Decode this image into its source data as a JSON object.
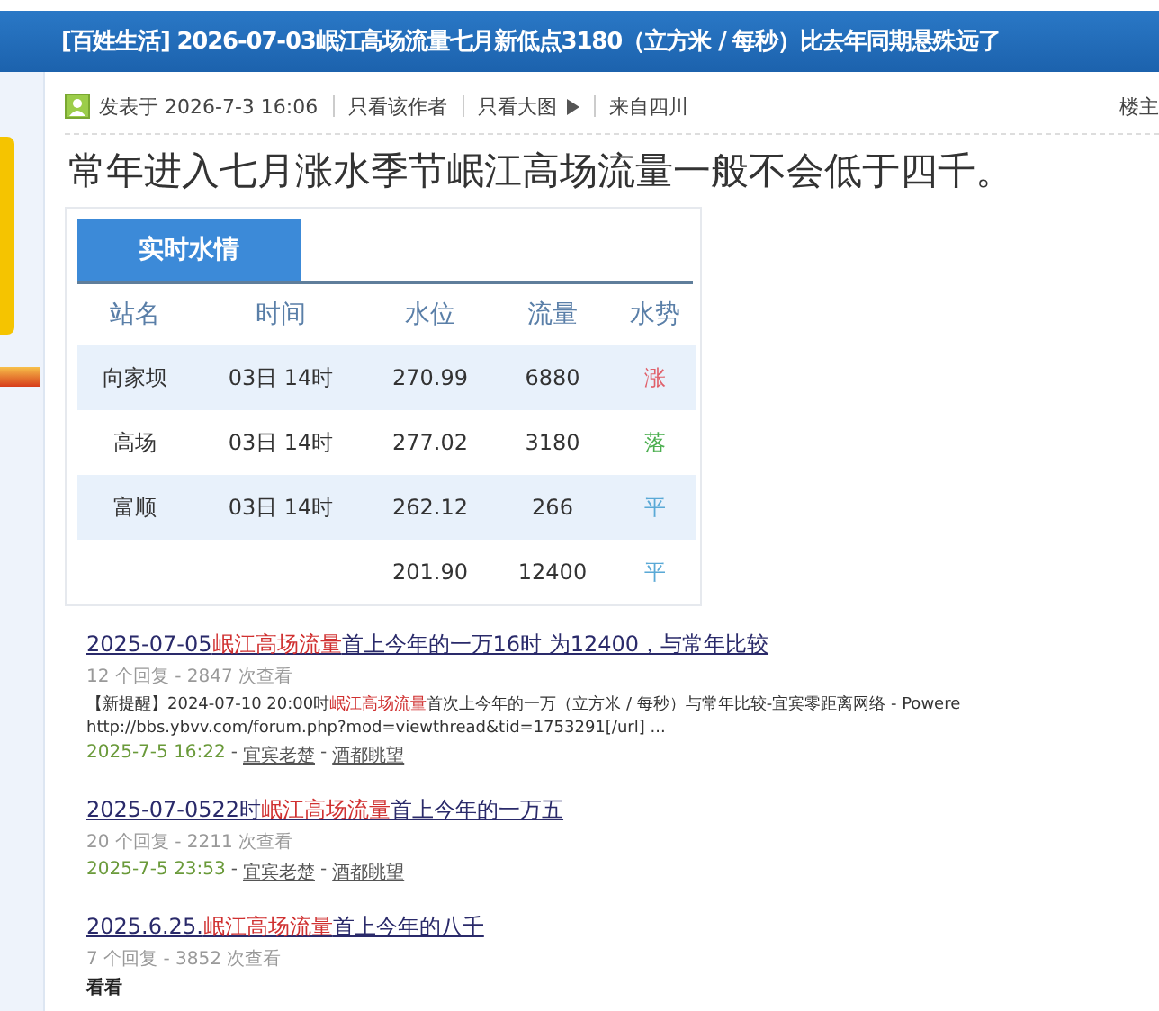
{
  "thread_title": "[百姓生活] 2026-07-03岷江高场流量七月新低点3180（立方米 / 每秒）比去年同期悬殊远了",
  "post_meta": {
    "posted": "发表于 2026-7-3 16:06",
    "only_author": "只看该作者",
    "only_images": "只看大图",
    "from": "来自四川",
    "floor": "楼主"
  },
  "headline": "常年进入七月涨水季节岷江高场流量一般不会低于四千。",
  "water_table": {
    "tab": "实时水情",
    "columns": [
      "站名",
      "时间",
      "水位",
      "流量",
      "水势"
    ],
    "rows": [
      {
        "station": "向家坝",
        "time": "03日 14时",
        "level": "270.99",
        "flow": "6880",
        "trend": "涨",
        "color": "#e0606a"
      },
      {
        "station": "高场",
        "time": "03日 14时",
        "level": "277.02",
        "flow": "3180",
        "trend": "落",
        "color": "#4caf50"
      },
      {
        "station": "富顺",
        "time": "03日 14时",
        "level": "262.12",
        "flow": "266",
        "trend": "平",
        "color": "#5aa9d6"
      },
      {
        "level": "201.90",
        "flow": "12400",
        "trend": "平",
        "color": "#5aa9d6"
      }
    ]
  },
  "results": [
    {
      "title": [
        {
          "text": "2025-07-05",
          "highlight": false
        },
        {
          "text": "岷江高场流量",
          "highlight": true
        },
        {
          "text": "首上今年的一万16时 为12400，与常年比较",
          "highlight": false
        }
      ],
      "stats": "12 个回复 - 2847 次查看",
      "snippet": [
        {
          "text": "【新提醒】2024-07-10 20:00时",
          "highlight": false
        },
        {
          "text": "岷江高场流量",
          "highlight": true
        },
        {
          "text": "首次上今年的一万（立方米 / 每秒）与常年比较-宜宾零距离网络 - Powere",
          "highlight": false
        }
      ],
      "url": "http://bbs.ybvv.com/forum.php?mod=viewthread&tid=1753291[/url] ...",
      "date": "2025-7-5 16:22",
      "dashes": [
        "-",
        "-"
      ],
      "author": "宜宾老楚",
      "forum": "酒都眺望"
    },
    {
      "title": [
        {
          "text": "2025-07-0522时",
          "highlight": false
        },
        {
          "text": "岷江高场流量",
          "highlight": true
        },
        {
          "text": "首上今年的一万五",
          "highlight": false
        }
      ],
      "stats": "20 个回复 - 2211 次查看",
      "date": "2025-7-5 23:53",
      "dashes": [
        "-",
        "-"
      ],
      "author": "宜宾老楚",
      "forum": "酒都眺望"
    },
    {
      "title": [
        {
          "text": "2025.6.25.",
          "highlight": false
        },
        {
          "text": "岷江高场流量",
          "highlight": true
        },
        {
          "text": "首上今年的八千",
          "highlight": false
        }
      ],
      "stats": "7 个回复 - 3852 次查看",
      "note": "看看"
    }
  ]
}
